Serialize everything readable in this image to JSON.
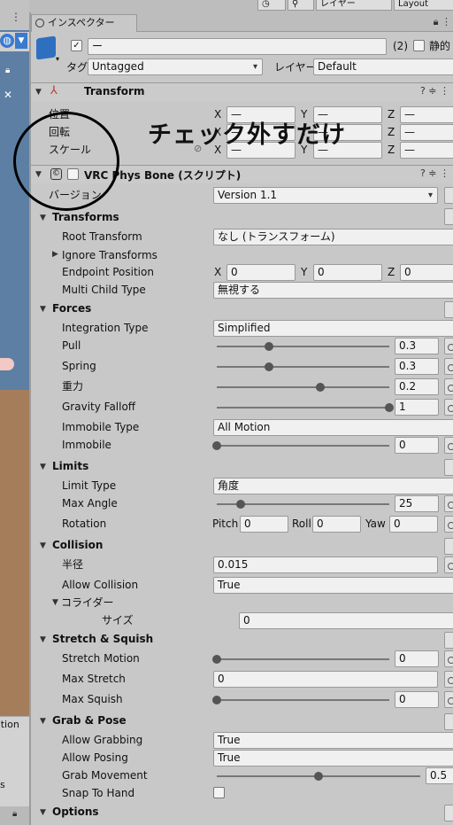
{
  "top": {
    "layer_button": "レイヤー",
    "layout_button": "Layout"
  },
  "tab": {
    "title": "インスペクター"
  },
  "object": {
    "name": "ー",
    "count": "(2)",
    "static_label": "静的",
    "tag_label": "タグ",
    "tag_value": "Untagged",
    "layer_label": "レイヤー",
    "layer_value": "Default"
  },
  "transform": {
    "title": "Transform",
    "rows": [
      {
        "label": "位置",
        "x": "—",
        "y": "—",
        "z": "—"
      },
      {
        "label": "回転",
        "x": "—",
        "y": "—",
        "z": "—"
      },
      {
        "label": "スケール",
        "x": "—",
        "y": "—",
        "z": "—"
      }
    ],
    "axis_x": "X",
    "axis_y": "Y",
    "axis_z": "Z"
  },
  "annotation": {
    "text": "チェック外すだけ"
  },
  "physbone": {
    "title": "VRC Phys Bone (スクリプト)",
    "version_label": "バージョン",
    "version_value": "Version 1.1",
    "transforms": {
      "title": "Transforms",
      "root_label": "Root Transform",
      "root_value": "なし (トランスフォーム)",
      "ignore_label": "Ignore Transforms",
      "endpoint_label": "Endpoint Position",
      "endpoint_x": "0",
      "endpoint_y": "0",
      "endpoint_z": "0",
      "multi_label": "Multi Child Type",
      "multi_value": "無視する"
    },
    "forces": {
      "title": "Forces",
      "integration_label": "Integration Type",
      "integration_value": "Simplified",
      "pull_label": "Pull",
      "pull_value": "0.3",
      "pull_level": 0.3,
      "spring_label": "Spring",
      "spring_value": "0.3",
      "spring_level": 0.3,
      "gravity_label": "重力",
      "gravity_value": "0.2",
      "gravity_level": 0.6,
      "falloff_label": "Gravity Falloff",
      "falloff_value": "1",
      "falloff_level": 1,
      "immobile_type_label": "Immobile Type",
      "immobile_type_value": "All Motion",
      "immobile_label": "Immobile",
      "immobile_value": "0",
      "immobile_level": 0
    },
    "limits": {
      "title": "Limits",
      "type_label": "Limit Type",
      "type_value": "角度",
      "angle_label": "Max Angle",
      "angle_value": "25",
      "angle_level": 0.14,
      "rotation_label": "Rotation",
      "pitch_label": "Pitch",
      "pitch_value": "0",
      "roll_label": "Roll",
      "roll_value": "0",
      "yaw_label": "Yaw",
      "yaw_value": "0"
    },
    "collision": {
      "title": "Collision",
      "radius_label": "半径",
      "radius_value": "0.015",
      "allow_label": "Allow Collision",
      "allow_value": "True",
      "colliders_label": "コライダー",
      "size_label": "サイズ",
      "size_value": "0"
    },
    "stretch": {
      "title": "Stretch & Squish",
      "motion_label": "Stretch Motion",
      "motion_value": "0",
      "motion_level": 0,
      "max_stretch_label": "Max Stretch",
      "max_stretch_value": "0",
      "max_squish_label": "Max Squish",
      "max_squish_value": "0",
      "max_squish_level": 0
    },
    "grab": {
      "title": "Grab & Pose",
      "allow_grab_label": "Allow Grabbing",
      "allow_grab_value": "True",
      "allow_pose_label": "Allow Posing",
      "allow_pose_value": "True",
      "movement_label": "Grab Movement",
      "movement_value": "0.5",
      "movement_level": 0.5,
      "snap_label": "Snap To Hand"
    },
    "options": {
      "title": "Options"
    }
  },
  "scene": {
    "bottom_text_1": "ation",
    "bottom_text_2": "s"
  }
}
